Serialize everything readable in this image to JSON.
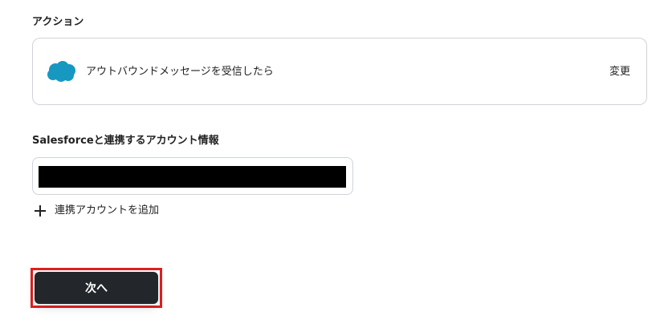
{
  "action_section": {
    "label": "アクション",
    "card": {
      "app_icon": "salesforce-cloud-icon",
      "app_color": "#1798c1",
      "action_text": "アウトバウンドメッセージを受信したら",
      "change_label": "変更"
    }
  },
  "account_section": {
    "label": "Salesforceと連携するアカウント情報",
    "selected_account": "",
    "add_account_label": "連携アカウントを追加",
    "add_icon": "plus-icon"
  },
  "footer": {
    "next_label": "次へ",
    "highlight_color": "#e0201f"
  }
}
